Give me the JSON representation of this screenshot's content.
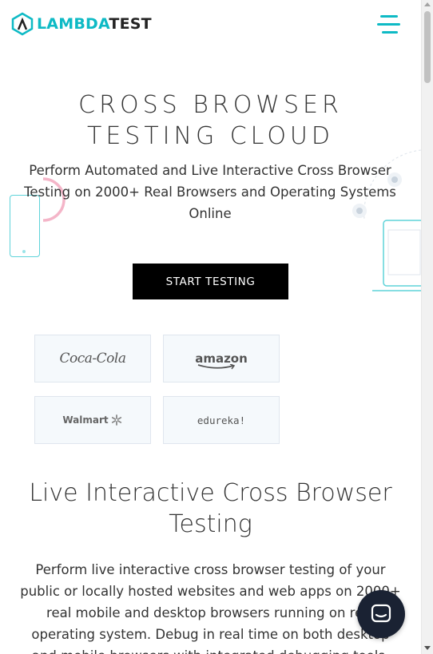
{
  "header": {
    "logo_part1": "LAMBDA",
    "logo_part2": "TEST",
    "menu_icon": "hamburger-menu-icon"
  },
  "hero": {
    "title_line1": "CROSS BROWSER",
    "title_line2": "TESTING CLOUD",
    "subtitle": "Perform Automated and Live Interactive Cross Browser Testing on 2000+ Real Browsers and Operating Systems Online",
    "cta_label": "START TESTING"
  },
  "brands": [
    {
      "name": "Coca-Cola"
    },
    {
      "name": "amazon"
    },
    {
      "name": "Walmart"
    },
    {
      "name": "edureka!"
    }
  ],
  "section": {
    "title": "Live Interactive Cross Browser Testing",
    "body": "Perform live interactive cross browser testing of your public or locally hosted websites and web apps on 2000+ real mobile and desktop browsers running on real operating system. Debug in real time on both desktop and mobile browsers with integrated debugging tools."
  },
  "chat": {
    "icon": "chat-bubble-icon"
  },
  "colors": {
    "brand_teal": "#0ebac5",
    "cta_bg": "#000000",
    "chat_bg": "#1a2233"
  }
}
